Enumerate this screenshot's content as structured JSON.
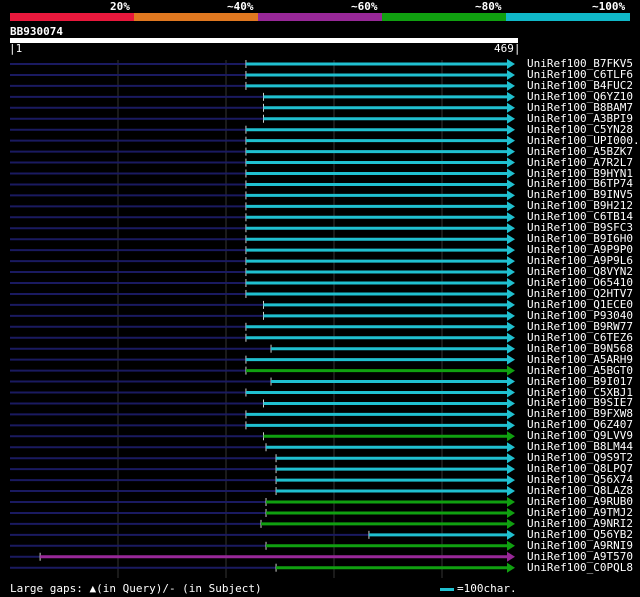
{
  "legend": {
    "labels": [
      "20%",
      "~40%",
      "~60%",
      "~80%",
      "~100%"
    ],
    "colors": [
      "#e8183c",
      "#e07820",
      "#982898",
      "#10a010",
      "#10b8c8"
    ]
  },
  "query": {
    "id": "BB930074",
    "start_label": "1",
    "end_label": "469",
    "length": 469
  },
  "hits": [
    {
      "name": "UniRef100_B7FKV5",
      "start": 470,
      "color": "cyan"
    },
    {
      "name": "UniRef100_C6TLF6",
      "start": 470,
      "color": "cyan"
    },
    {
      "name": "UniRef100_B4FUC2",
      "start": 470,
      "color": "cyan"
    },
    {
      "name": "UniRef100_Q6YZ10",
      "start": 505,
      "color": "cyan"
    },
    {
      "name": "UniRef100_B8BAM7",
      "start": 505,
      "color": "cyan"
    },
    {
      "name": "UniRef100_A3BPI9",
      "start": 505,
      "color": "cyan"
    },
    {
      "name": "UniRef100_C5YN28",
      "start": 470,
      "color": "cyan"
    },
    {
      "name": "UniRef100_UPI000...",
      "start": 470,
      "color": "cyan"
    },
    {
      "name": "UniRef100_A5BZK7",
      "start": 470,
      "color": "cyan"
    },
    {
      "name": "UniRef100_A7R2L7",
      "start": 470,
      "color": "cyan"
    },
    {
      "name": "UniRef100_B9HYN1",
      "start": 470,
      "color": "cyan"
    },
    {
      "name": "UniRef100_B6TP74",
      "start": 470,
      "color": "cyan"
    },
    {
      "name": "UniRef100_B9INV5",
      "start": 470,
      "color": "cyan"
    },
    {
      "name": "UniRef100_B9H212",
      "start": 470,
      "color": "cyan"
    },
    {
      "name": "UniRef100_C6TB14",
      "start": 470,
      "color": "cyan"
    },
    {
      "name": "UniRef100_B9SFC3",
      "start": 470,
      "color": "cyan"
    },
    {
      "name": "UniRef100_B9I6H0",
      "start": 470,
      "color": "cyan"
    },
    {
      "name": "UniRef100_A9P9P0",
      "start": 470,
      "color": "cyan"
    },
    {
      "name": "UniRef100_A9P9L6",
      "start": 470,
      "color": "cyan"
    },
    {
      "name": "UniRef100_Q8VYN2",
      "start": 470,
      "color": "cyan"
    },
    {
      "name": "UniRef100_O65410",
      "start": 470,
      "color": "cyan"
    },
    {
      "name": "UniRef100_Q2HTV7",
      "start": 470,
      "color": "cyan"
    },
    {
      "name": "UniRef100_Q1ECE0",
      "start": 505,
      "color": "cyan"
    },
    {
      "name": "UniRef100_P93040",
      "start": 505,
      "color": "cyan"
    },
    {
      "name": "UniRef100_B9RW77",
      "start": 470,
      "color": "cyan"
    },
    {
      "name": "UniRef100_C6TEZ6",
      "start": 470,
      "color": "cyan"
    },
    {
      "name": "UniRef100_B9N568",
      "start": 520,
      "color": "cyan"
    },
    {
      "name": "UniRef100_A5ARH9",
      "start": 470,
      "color": "cyan"
    },
    {
      "name": "UniRef100_A5BGT0",
      "start": 470,
      "color": "green"
    },
    {
      "name": "UniRef100_B9I017",
      "start": 520,
      "color": "cyan"
    },
    {
      "name": "UniRef100_C5XBJ1",
      "start": 470,
      "color": "cyan"
    },
    {
      "name": "UniRef100_B9SIE7",
      "start": 505,
      "color": "cyan"
    },
    {
      "name": "UniRef100_B9FXW8",
      "start": 470,
      "color": "cyan"
    },
    {
      "name": "UniRef100_Q6Z407",
      "start": 470,
      "color": "cyan"
    },
    {
      "name": "UniRef100_Q9LVV9",
      "start": 505,
      "color": "green"
    },
    {
      "name": "UniRef100_B8LM44",
      "start": 510,
      "color": "cyan"
    },
    {
      "name": "UniRef100_Q9S9T2",
      "start": 530,
      "color": "cyan"
    },
    {
      "name": "UniRef100_Q8LPQ7",
      "start": 530,
      "color": "cyan"
    },
    {
      "name": "UniRef100_Q56X74",
      "start": 530,
      "color": "cyan"
    },
    {
      "name": "UniRef100_Q8LAZ8",
      "start": 530,
      "color": "cyan"
    },
    {
      "name": "UniRef100_A9RUB0",
      "start": 510,
      "color": "green"
    },
    {
      "name": "UniRef100_A9TMJ2",
      "start": 510,
      "color": "green"
    },
    {
      "name": "UniRef100_A9NRI2",
      "start": 500,
      "color": "green"
    },
    {
      "name": "UniRef100_Q56YB2",
      "start": 715,
      "color": "cyan"
    },
    {
      "name": "UniRef100_A9RNI9",
      "start": 510,
      "color": "green"
    },
    {
      "name": "UniRef100_A9T570",
      "start": 60,
      "color": "purple"
    },
    {
      "name": "UniRef100_C0PQL8",
      "start": 530,
      "color": "green"
    }
  ],
  "footer": {
    "gap_text": "Large gaps: ▲(in Query)/- (in Subject)",
    "scale_text": "=100char."
  }
}
